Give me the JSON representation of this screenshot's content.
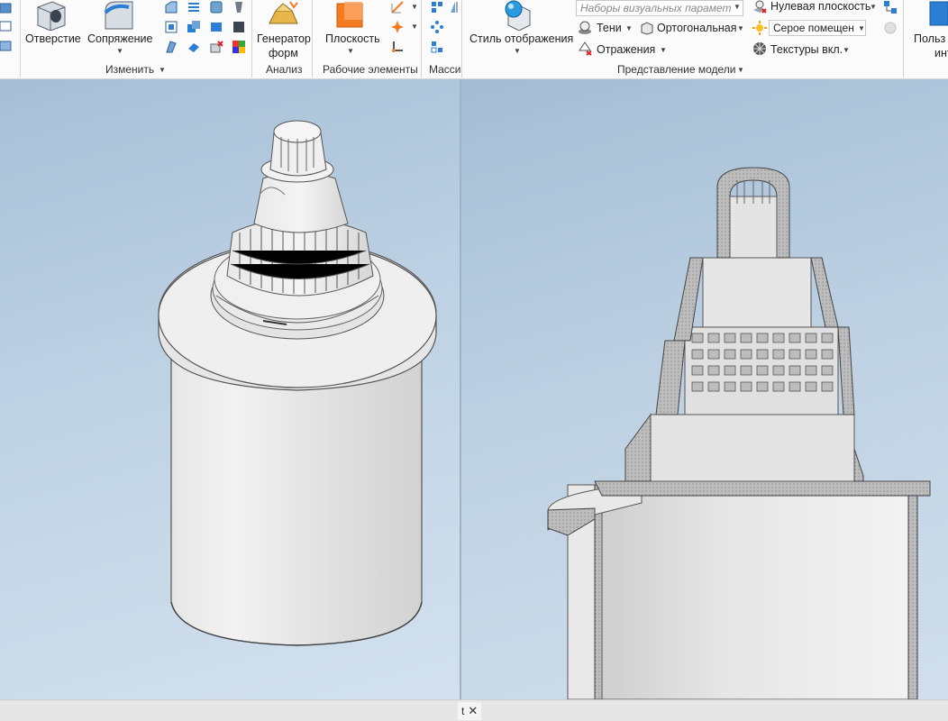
{
  "ribbon": {
    "modify": {
      "hole_label": "Отверстие",
      "fillet_label": "Сопряжение",
      "group_label": "Изменить"
    },
    "analysis": {
      "shape_generator_label_1": "Генератор",
      "shape_generator_label_2": "форм",
      "group_label": "Анализ"
    },
    "work_features": {
      "plane_label": "Плоскость",
      "group_label": "Рабочие элементы"
    },
    "pattern": {
      "group_label": "Масси"
    },
    "view": {
      "visual_style_label": "Стиль отображения",
      "visual_presets_placeholder": "Наборы визуальных парамет",
      "shadows_label": "Тени",
      "orthographic_label": "Ортогональная",
      "reflections_label": "Отражения",
      "ground_plane_label": "Нулевая плоскость",
      "lighting_value": "Серое помещен",
      "textures_label": "Текстуры вкл.",
      "group_label": "Представление модели"
    },
    "user": {
      "label_1": "Польз",
      "label_2": "инт"
    }
  },
  "bottom": {
    "tab_text": "t",
    "close_glyph": "✕"
  },
  "colors": {
    "accent": "#f47b20",
    "blue": "#2a7fd4",
    "viewport_top": "#a7bfd6",
    "viewport_bottom": "#d3e1ee"
  }
}
